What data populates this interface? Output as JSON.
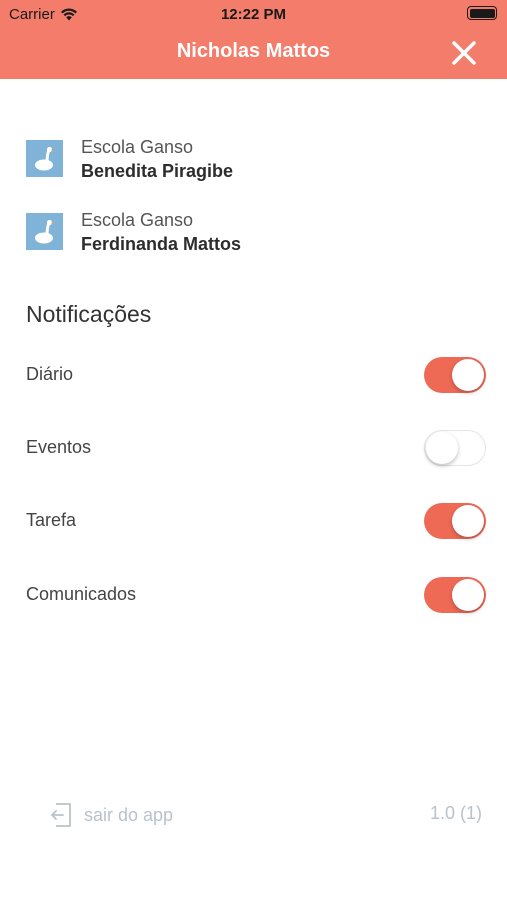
{
  "status_bar": {
    "carrier": "Carrier",
    "time": "12:22 PM",
    "battery": "full"
  },
  "header": {
    "title": "Nicholas Mattos",
    "close_icon": "close-icon",
    "color": "#f47c6a"
  },
  "schools": [
    {
      "school": "Escola Ganso",
      "student": "Benedita Piragibe",
      "icon": "goose-icon"
    },
    {
      "school": "Escola Ganso",
      "student": "Ferdinanda Mattos",
      "icon": "goose-icon"
    }
  ],
  "notifications": {
    "title": "Notificações",
    "items": [
      {
        "label": "Diário",
        "enabled": true
      },
      {
        "label": "Eventos",
        "enabled": false
      },
      {
        "label": "Tarefa",
        "enabled": true
      },
      {
        "label": "Comunicados",
        "enabled": true
      }
    ]
  },
  "footer": {
    "exit_label": "sair do app",
    "exit_icon": "exit-icon",
    "version": "1.0 (1)"
  },
  "colors": {
    "accent": "#ef6a55",
    "muted": "#b8c2cc"
  }
}
